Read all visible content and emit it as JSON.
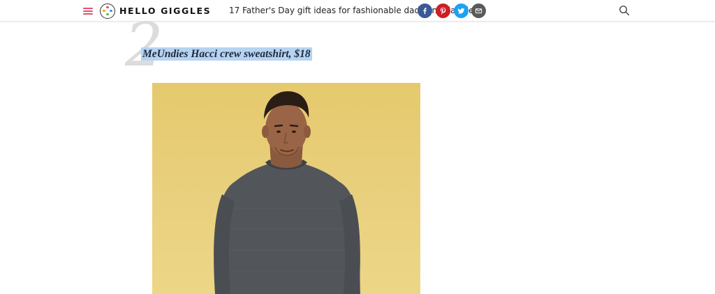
{
  "header": {
    "brand_name": "HELLO GIGGLES",
    "article_headline": "17 Father's Day gift ideas for fashionable dads and daddies",
    "share_icons": [
      "facebook-icon",
      "pinterest-icon",
      "twitter-icon",
      "email-icon"
    ],
    "colors": {
      "menu": "#e0526e",
      "facebook": "#3b5998",
      "pinterest": "#cb2027",
      "twitter": "#1da1f2",
      "email": "#5a5a5a"
    }
  },
  "item": {
    "number": "2",
    "title": "MeUndies Hacci crew sweatshirt, $18",
    "title_highlight_color": "#b6d3f2",
    "photo_background": "#e8cd78"
  }
}
